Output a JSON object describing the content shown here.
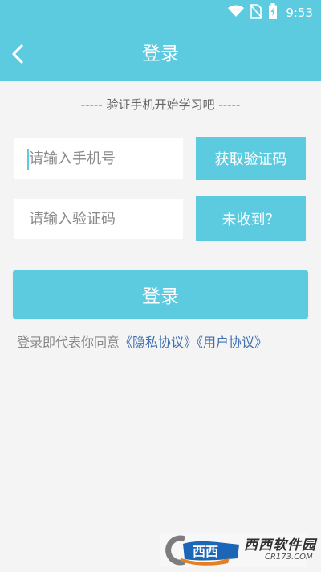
{
  "status_bar": {
    "time": "9:53"
  },
  "header": {
    "title": "登录",
    "back_icon": "chevron-left-icon"
  },
  "subtitle": "----- 验证手机开始学习吧 -----",
  "phone_field": {
    "placeholder": "请输入手机号",
    "value": ""
  },
  "get_code_button": {
    "label": "获取验证码"
  },
  "code_field": {
    "placeholder": "请输入验证码",
    "value": ""
  },
  "not_received_button": {
    "label": "未收到？"
  },
  "login_button": {
    "label": "登录"
  },
  "agreement": {
    "prefix": "登录即代表你同意",
    "privacy_link": "《隐私协议》",
    "user_link": "《用户协议》"
  },
  "watermark": {
    "title": "西西软件园",
    "url": "CR173.COM",
    "logo_icon": "cr-logo-icon"
  },
  "colors": {
    "accent": "#5ccbe0",
    "link": "#3f6fb1",
    "background": "#f4f4f4"
  }
}
